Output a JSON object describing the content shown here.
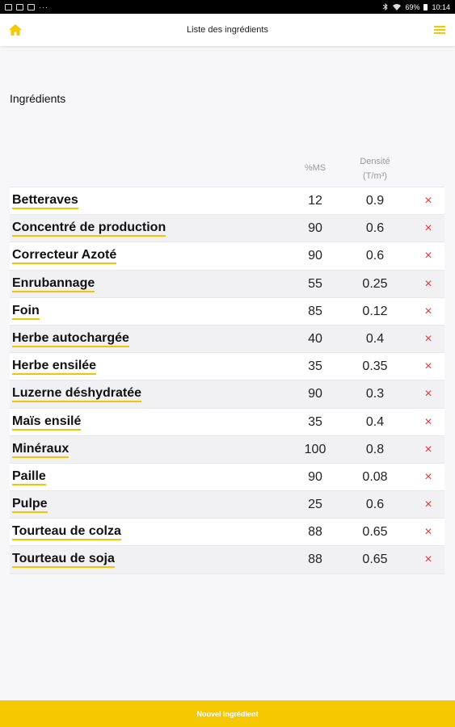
{
  "status_bar": {
    "battery": "69%",
    "time": "10:14",
    "more": "···"
  },
  "header": {
    "title": "Liste des ingrédients",
    "home_icon": "home-icon",
    "menu_icon": "hamburger-menu-icon"
  },
  "section": {
    "title": "Ingrédients"
  },
  "table": {
    "col_ms": "%MS",
    "col_density_line1": "Densité",
    "col_density_line2": "(T/m³)",
    "delete_glyph": "×",
    "rows": [
      {
        "name": "Betteraves",
        "ms": "12",
        "density": "0.9"
      },
      {
        "name": "Concentré de production",
        "ms": "90",
        "density": "0.6"
      },
      {
        "name": "Correcteur Azoté",
        "ms": "90",
        "density": "0.6"
      },
      {
        "name": "Enrubannage",
        "ms": "55",
        "density": "0.25"
      },
      {
        "name": "Foin",
        "ms": "85",
        "density": "0.12"
      },
      {
        "name": "Herbe autochargée",
        "ms": "40",
        "density": "0.4"
      },
      {
        "name": "Herbe ensilée",
        "ms": "35",
        "density": "0.35"
      },
      {
        "name": "Luzerne déshydratée",
        "ms": "90",
        "density": "0.3"
      },
      {
        "name": "Maïs ensilé",
        "ms": "35",
        "density": "0.4"
      },
      {
        "name": "Minéraux",
        "ms": "100",
        "density": "0.8"
      },
      {
        "name": "Paille",
        "ms": "90",
        "density": "0.08"
      },
      {
        "name": "Pulpe",
        "ms": "25",
        "density": "0.6"
      },
      {
        "name": "Tourteau de colza",
        "ms": "88",
        "density": "0.65"
      },
      {
        "name": "Tourteau de soja",
        "ms": "88",
        "density": "0.65"
      }
    ]
  },
  "footer": {
    "new_ingredient_label": "Nouvel ingrédient"
  },
  "colors": {
    "accent": "#f5c800",
    "delete": "#e53935"
  }
}
